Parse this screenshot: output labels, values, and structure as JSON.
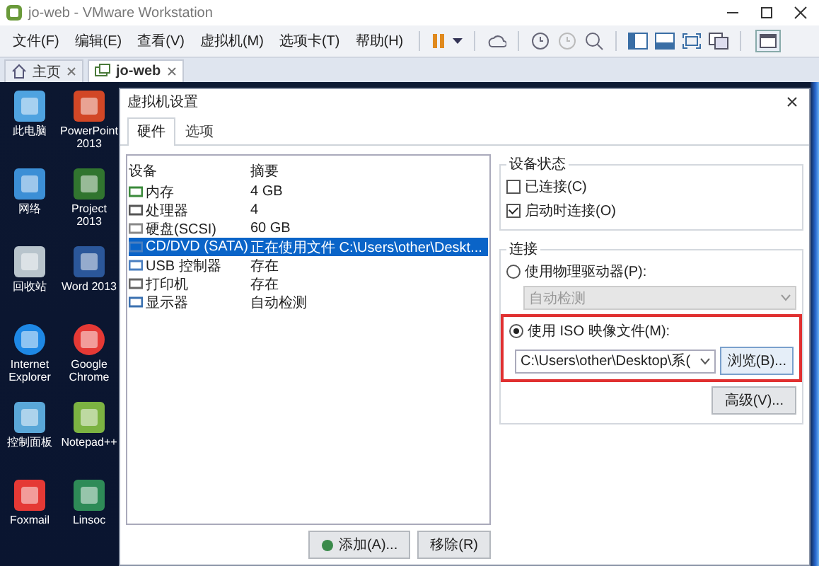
{
  "window": {
    "title": "jo-web - VMware Workstation"
  },
  "menu": [
    "文件(F)",
    "编辑(E)",
    "查看(V)",
    "虚拟机(M)",
    "选项卡(T)",
    "帮助(H)"
  ],
  "tabs": [
    {
      "label": "主页",
      "selected": false
    },
    {
      "label": "jo-web",
      "selected": true
    }
  ],
  "desktop_icons": [
    {
      "label": "此电脑"
    },
    {
      "label": "PowerPoint 2013"
    },
    {
      "label": "网络"
    },
    {
      "label": "Project 2013"
    },
    {
      "label": "回收站"
    },
    {
      "label": "Word 2013"
    },
    {
      "label": "Internet Explorer"
    },
    {
      "label": "Google Chrome"
    },
    {
      "label": "控制面板"
    },
    {
      "label": "Notepad++"
    },
    {
      "label": "Foxmail"
    },
    {
      "label": "Linsoc"
    }
  ],
  "dialog": {
    "title": "虚拟机设置",
    "tabs": [
      {
        "label": "硬件",
        "selected": true
      },
      {
        "label": "选项",
        "selected": false
      }
    ],
    "device_table": {
      "columns": [
        "设备",
        "摘要"
      ],
      "rows": [
        {
          "device": "内存",
          "summary": "4 GB",
          "selected": false
        },
        {
          "device": "处理器",
          "summary": "4",
          "selected": false
        },
        {
          "device": "硬盘(SCSI)",
          "summary": "60 GB",
          "selected": false
        },
        {
          "device": "CD/DVD (SATA)",
          "summary": "正在使用文件 C:\\Users\\other\\Deskt...",
          "selected": true
        },
        {
          "device": "USB 控制器",
          "summary": "存在",
          "selected": false
        },
        {
          "device": "打印机",
          "summary": "存在",
          "selected": false
        },
        {
          "device": "显示器",
          "summary": "自动检测",
          "selected": false
        }
      ]
    },
    "add_button": "添加(A)...",
    "remove_button": "移除(R)",
    "device_status": {
      "title": "设备状态",
      "options": [
        {
          "label": "已连接(C)",
          "checked": false
        },
        {
          "label": "启动时连接(O)",
          "checked": true
        }
      ]
    },
    "connection": {
      "title": "连接",
      "physical": {
        "label": "使用物理驱动器(P):",
        "selected": false
      },
      "drive_select": {
        "value": "自动检测",
        "disabled": true
      },
      "iso": {
        "label": "使用 ISO 映像文件(M):",
        "selected": true
      },
      "iso_path": {
        "value": "C:\\Users\\other\\Desktop\\系("
      },
      "browse_button": "浏览(B)...",
      "advanced_button": "高级(V)..."
    }
  }
}
